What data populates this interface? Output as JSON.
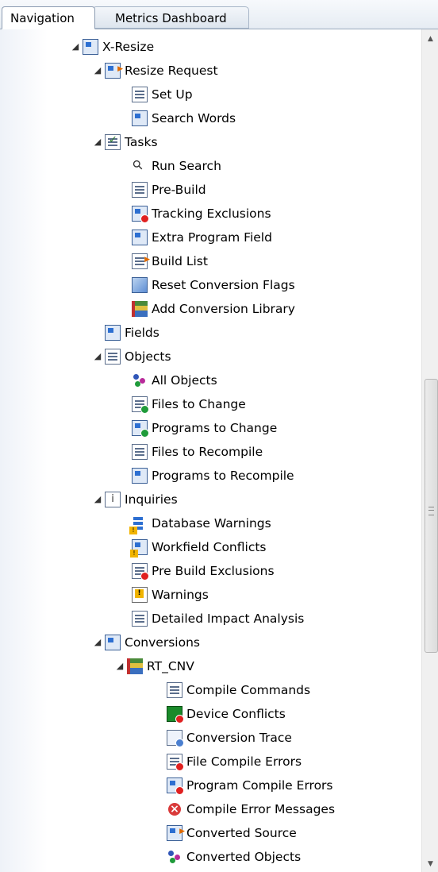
{
  "tabs": [
    {
      "label": "Navigation"
    },
    {
      "label": "Metrics Dashboard"
    }
  ],
  "tree": [
    {
      "label": "X-Resize",
      "icon": "resize-window-icon"
    },
    {
      "label": "Resize Request",
      "icon": "request-icon"
    },
    {
      "label": "Set Up",
      "icon": "setup-icon"
    },
    {
      "label": "Search Words",
      "icon": "search-words-icon"
    },
    {
      "label": "Tasks",
      "icon": "tasks-icon"
    },
    {
      "label": "Run Search",
      "icon": "run-search-icon"
    },
    {
      "label": "Pre-Build",
      "icon": "pre-build-icon"
    },
    {
      "label": "Tracking Exclusions",
      "icon": "tracking-exclusions-icon"
    },
    {
      "label": "Extra Program Field",
      "icon": "extra-program-field-icon"
    },
    {
      "label": "Build List",
      "icon": "build-list-icon"
    },
    {
      "label": "Reset Conversion Flags",
      "icon": "reset-flags-icon"
    },
    {
      "label": "Add Conversion Library",
      "icon": "add-library-icon"
    },
    {
      "label": "Fields",
      "icon": "fields-icon"
    },
    {
      "label": "Objects",
      "icon": "objects-icon"
    },
    {
      "label": "All Objects",
      "icon": "all-objects-icon"
    },
    {
      "label": "Files to Change",
      "icon": "files-to-change-icon"
    },
    {
      "label": "Programs to Change",
      "icon": "programs-to-change-icon"
    },
    {
      "label": "Files to Recompile",
      "icon": "files-to-recompile-icon"
    },
    {
      "label": "Programs to Recompile",
      "icon": "programs-to-recompile-icon"
    },
    {
      "label": "Inquiries",
      "icon": "inquiries-icon"
    },
    {
      "label": "Database Warnings",
      "icon": "database-warning-icon"
    },
    {
      "label": "Workfield Conflicts",
      "icon": "workfield-conflict-icon"
    },
    {
      "label": "Pre Build Exclusions",
      "icon": "pre-build-exclusions-icon"
    },
    {
      "label": "Warnings",
      "icon": "warning-icon"
    },
    {
      "label": "Detailed Impact Analysis",
      "icon": "impact-analysis-icon"
    },
    {
      "label": "Conversions",
      "icon": "conversions-icon"
    },
    {
      "label": "RT_CNV",
      "icon": "library-icon"
    },
    {
      "label": "Compile Commands",
      "icon": "compile-commands-icon"
    },
    {
      "label": "Device Conflicts",
      "icon": "device-conflicts-icon"
    },
    {
      "label": "Conversion Trace",
      "icon": "conversion-trace-icon"
    },
    {
      "label": "File Compile Errors",
      "icon": "file-compile-errors-icon"
    },
    {
      "label": "Program Compile Errors",
      "icon": "program-compile-errors-icon"
    },
    {
      "label": "Compile Error Messages",
      "icon": "error-circle-icon"
    },
    {
      "label": "Converted Source",
      "icon": "converted-source-icon"
    },
    {
      "label": "Converted Objects",
      "icon": "converted-objects-icon"
    }
  ]
}
